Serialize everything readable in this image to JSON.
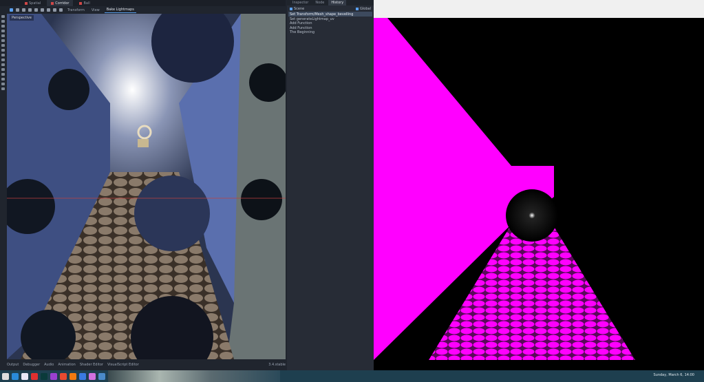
{
  "editor": {
    "tabs": [
      {
        "label": "Spatial"
      },
      {
        "label": "Corridor"
      },
      {
        "label": "Ball"
      }
    ],
    "toolbar": {
      "transform": "Transform",
      "view": "View",
      "bake": "Bake Lightmaps"
    },
    "viewport_label": "Perspective",
    "bottom_tabs": [
      "Output",
      "Debugger",
      "Audio",
      "Animation",
      "Shader Editor",
      "VisualScript Editor"
    ],
    "version": "3.4.stable"
  },
  "dock": {
    "tabs": [
      "Inspector",
      "Node",
      "History"
    ],
    "scene_label": "Scene",
    "global_label": "Global",
    "history": [
      "Set Transform/Mesh_shape_bevelling",
      "Set generateLightmap_uv",
      "Add Function",
      "Add Function",
      "The Beginning"
    ]
  },
  "taskbar": {
    "clock": "Sunday, March 6, 14:00"
  },
  "colors": {
    "magenta": "#ff00ff",
    "accent": "#5aa0f0"
  }
}
